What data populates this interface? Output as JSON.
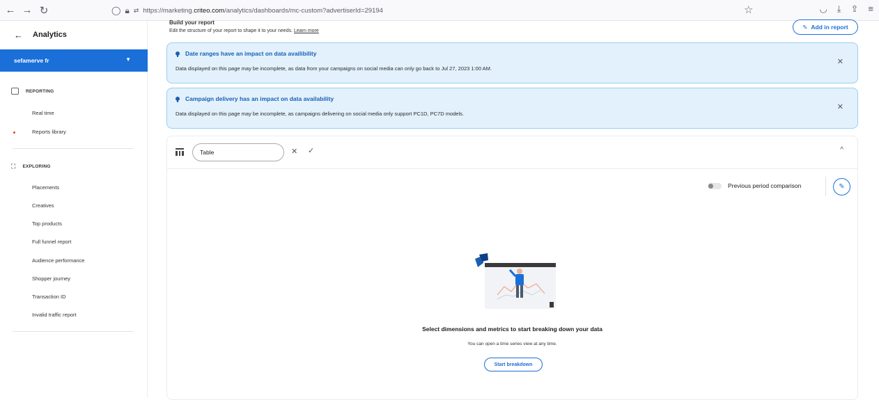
{
  "browser": {
    "url_prefix": "https://marketing.",
    "url_domain": "criteo.com",
    "url_suffix": "/analytics/dashboards/mc-custom?advertiserId=29194"
  },
  "sidebar": {
    "title": "Analytics",
    "account": "sefamerve fr",
    "reporting": {
      "label": "REPORTING",
      "items": [
        "Real time",
        "Reports library"
      ]
    },
    "exploring": {
      "label": "EXPLORING",
      "items": [
        "Placements",
        "Creatives",
        "Top products",
        "Full funnel report",
        "Audience performance",
        "Shopper journey",
        "Transaction ID",
        "Invalid traffic report"
      ]
    }
  },
  "main": {
    "build_title": "Build your report",
    "build_subtitle": "Edit the structure of your report to shape it to your needs.",
    "learn_more": "Learn more",
    "add_report": "Add in report",
    "banners": [
      {
        "title": "Date ranges have an impact on data availibility",
        "text": "Data displayed on this page may be incomplete, as data from your campaigns on social media can only go back to Jul 27, 2023 1:00 AM."
      },
      {
        "title": "Campaign delivery has an impact on data availability",
        "text": "Data displayed on this page may be incomplete, as campaigns delivering on social media only support PC1D, PC7D models."
      }
    ],
    "card": {
      "name_value": "Table",
      "comparison_label": "Previous period comparison",
      "empty_title": "Select dimensions and metrics to start breaking down your data",
      "empty_subtitle": "You can open a time series view at any time.",
      "start_button": "Start breakdown"
    }
  },
  "colors": {
    "accent": "#1a6fd9",
    "banner_bg": "#e2f1fc",
    "banner_border": "#9ccdf2"
  }
}
